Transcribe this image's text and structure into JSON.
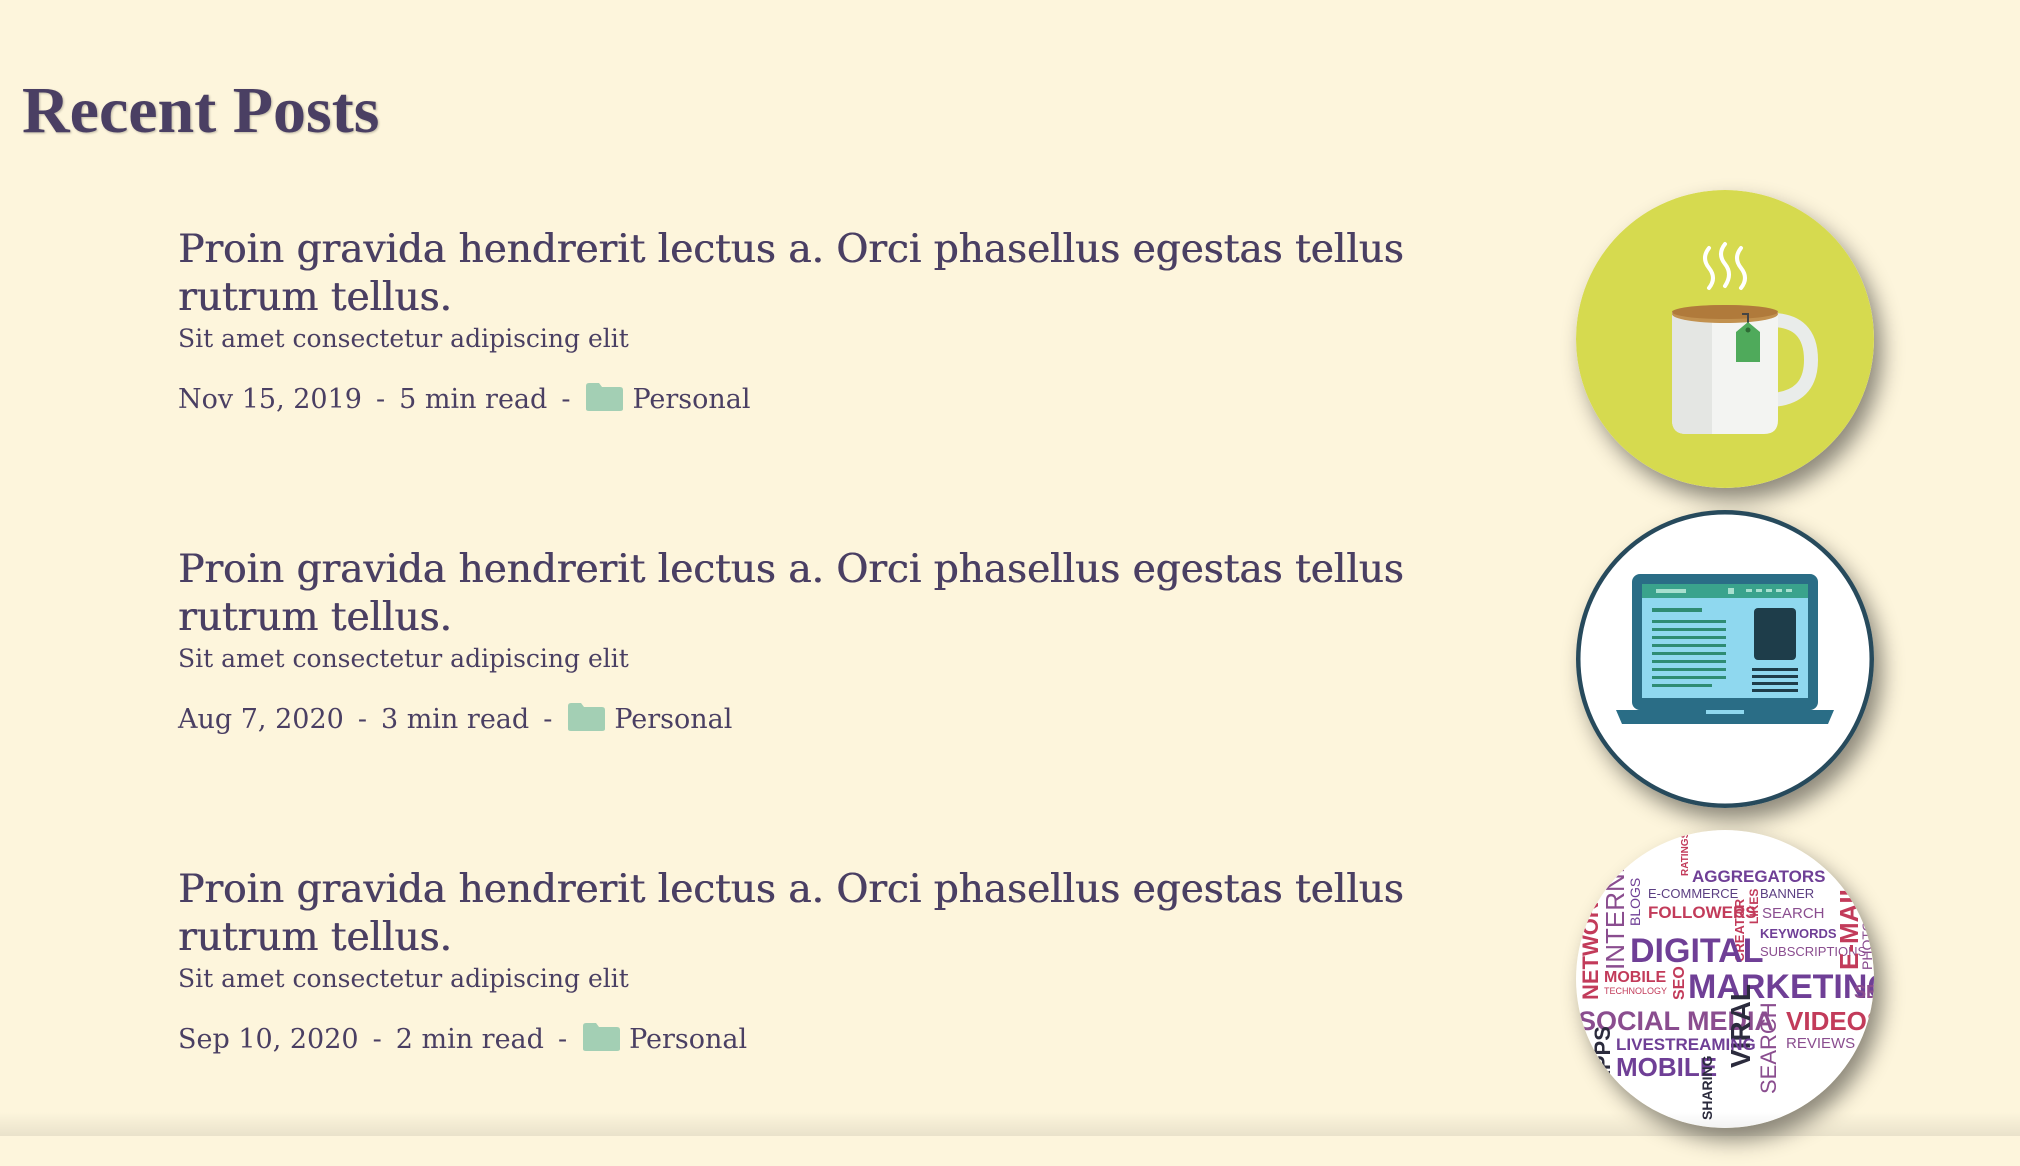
{
  "page": {
    "title": "Recent Posts"
  },
  "colors": {
    "background": "#fdf5dc",
    "text": "#4a3f63",
    "folder": "#a3cfb4"
  },
  "posts": [
    {
      "title": "Proin gravida hendrerit lectus a. Orci phasellus egestas tellus rutrum tellus.",
      "subtitle": "Sit amet consectetur adipiscing elit",
      "date": "Nov 15, 2019",
      "read_time": "5 min read",
      "separator": "-",
      "category": "Personal",
      "category_icon": "folder-icon",
      "thumbnail": "tea-mug-icon"
    },
    {
      "title": "Proin gravida hendrerit lectus a. Orci phasellus egestas tellus rutrum tellus.",
      "subtitle": "Sit amet consectetur adipiscing elit",
      "date": "Aug 7, 2020",
      "read_time": "3 min read",
      "separator": "-",
      "category": "Personal",
      "category_icon": "folder-icon",
      "thumbnail": "laptop-webpage-icon"
    },
    {
      "title": "Proin gravida hendrerit lectus a. Orci phasellus egestas tellus rutrum tellus.",
      "subtitle": "Sit amet consectetur adipiscing elit",
      "date": "Sep 10, 2020",
      "read_time": "2 min read",
      "separator": "-",
      "category": "Personal",
      "category_icon": "folder-icon",
      "thumbnail": "digital-marketing-word-cloud"
    }
  ],
  "word_cloud": {
    "words": [
      "AGGREGATORS",
      "RATINGS",
      "E-COMMERCE",
      "BANNER",
      "FOLLOWERS",
      "LIKES",
      "SEARCH",
      "BLOGS",
      "CREATOR",
      "INTERNET",
      "KEYWORDS",
      "NETWORK",
      "DIGITAL",
      "SUBSCRIPTIONS",
      "E-MAIL",
      "PHOTO S",
      "MOBILE",
      "TECHNOLOGY",
      "SEO",
      "MARKETING",
      "SEM",
      "SOCIAL MEDIA",
      "VIRAL",
      "VIDEOS",
      "SEARCH",
      "REVIEWS",
      "APPS",
      "LIVESTREAMING",
      "MOBILE",
      "SHARING"
    ]
  }
}
